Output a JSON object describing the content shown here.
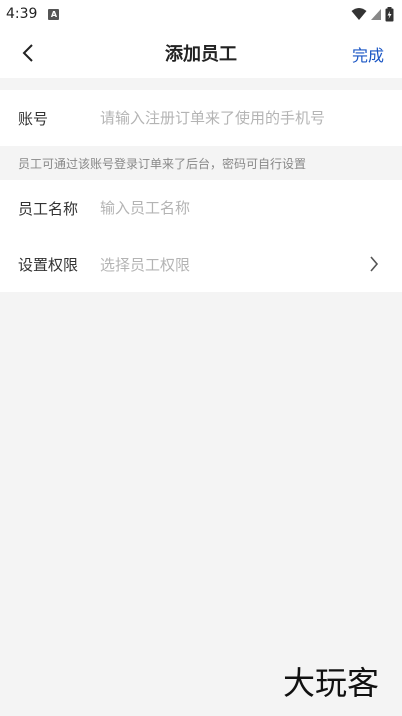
{
  "status_bar": {
    "time": "4:39",
    "app_icon_letter": "A"
  },
  "nav": {
    "title": "添加员工",
    "done_label": "完成"
  },
  "form": {
    "account": {
      "label": "账号",
      "placeholder": "请输入注册订单来了使用的手机号",
      "value": ""
    },
    "hint": "员工可通过该账号登录订单来了后台，密码可自行设置",
    "name": {
      "label": "员工名称",
      "placeholder": "输入员工名称",
      "value": ""
    },
    "permission": {
      "label": "设置权限",
      "placeholder": "选择员工权限"
    }
  },
  "watermark": {
    "text": "大玩客"
  },
  "colors": {
    "accent": "#1a56c4",
    "background": "#f4f4f4"
  },
  "icons": {
    "back": "chevron-left-icon",
    "permission_arrow": "chevron-right-icon",
    "wifi": "wifi-icon",
    "signal": "signal-icon",
    "battery": "battery-icon"
  }
}
